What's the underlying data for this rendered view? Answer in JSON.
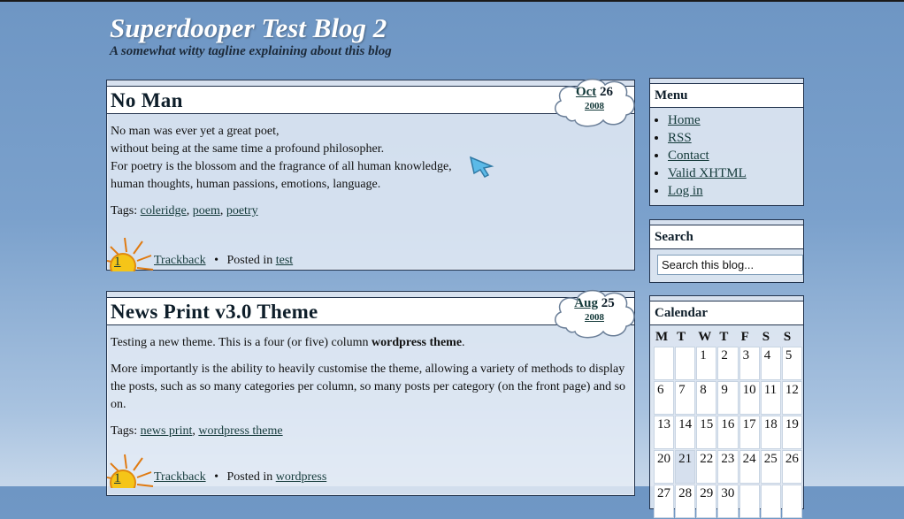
{
  "blog": {
    "title": "Superdooper Test Blog 2",
    "tagline": "A somewhat witty tagline explaining about this blog"
  },
  "posts": [
    {
      "title": "No Man",
      "date": {
        "month": "Oct",
        "day": "26",
        "year": "2008"
      },
      "lines": [
        "No man was ever yet a great poet,",
        "without being at the same time a profound philosopher.",
        "For poetry is the blossom and the fragrance of all human knowledge,",
        "human thoughts, human passions, emotions, language."
      ],
      "tags_label": "Tags:",
      "tags": [
        "coleridge",
        "poem",
        "poetry"
      ],
      "comment_count": "1",
      "trackback": "Trackback",
      "bullet": "•",
      "posted_in": "Posted in",
      "category": "test"
    },
    {
      "title": "News Print v3.0 Theme",
      "date": {
        "month": "Aug",
        "day": "25",
        "year": "2008"
      },
      "p1_pre": "Testing a new theme. This is a four (or five) column ",
      "p1_bold": "wordpress theme",
      "p1_post": ".",
      "p2": "More importantly is the ability to heavily customise the theme, allowing a variety of methods to display the posts, such as so many categories per column, so many posts per category (on the front page) and so on.",
      "tags_label": "Tags:",
      "tags": [
        "news print",
        "wordpress theme"
      ],
      "comment_count": "1",
      "trackback": "Trackback",
      "bullet": "•",
      "posted_in": "Posted in",
      "category": "wordpress"
    }
  ],
  "sidebar": {
    "menu": {
      "title": "Menu",
      "items": [
        "Home",
        "RSS",
        "Contact",
        "Valid XHTML",
        "Log in"
      ]
    },
    "search": {
      "title": "Search",
      "placeholder": "Search this blog..."
    },
    "calendar": {
      "title": "Calendar",
      "headers": [
        "M",
        "T",
        "W",
        "T",
        "F",
        "S",
        "S"
      ],
      "rows": [
        [
          "",
          "",
          "1",
          "2",
          "3",
          "4",
          "5"
        ],
        [
          "6",
          "7",
          "8",
          "9",
          "10",
          "11",
          "12"
        ],
        [
          "13",
          "14",
          "15",
          "16",
          "17",
          "18",
          "19"
        ],
        [
          "20",
          "21",
          "22",
          "23",
          "24",
          "25",
          "26"
        ],
        [
          "27",
          "28",
          "29",
          "30",
          "",
          "",
          ""
        ]
      ],
      "today": "21"
    }
  },
  "colors": {
    "link": "#143a3a",
    "border": "#22334d",
    "title_white": "#ffffff"
  }
}
